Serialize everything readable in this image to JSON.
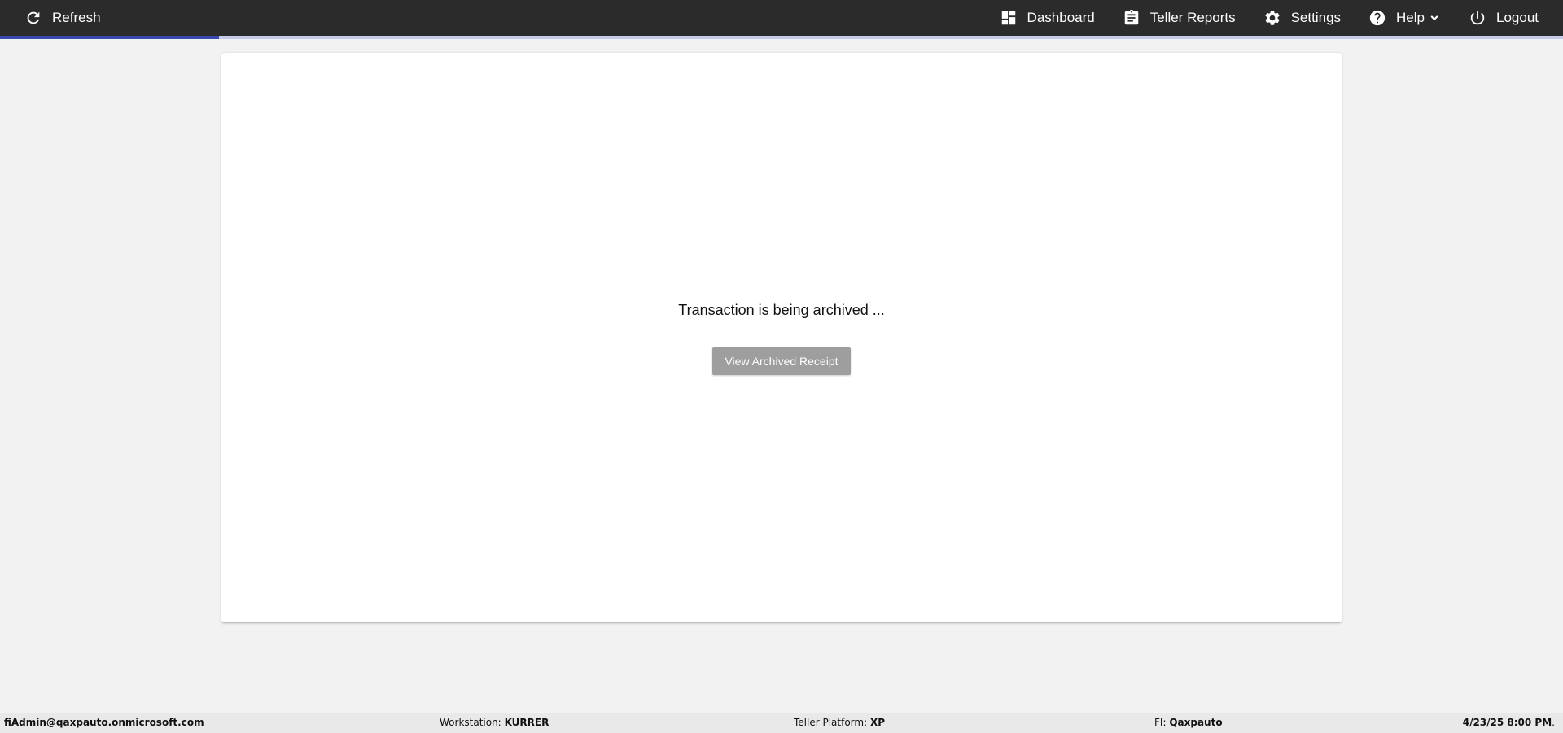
{
  "toolbar": {
    "refresh_label": "Refresh",
    "dashboard_label": "Dashboard",
    "teller_reports_label": "Teller Reports",
    "settings_label": "Settings",
    "help_label": "Help",
    "logout_label": "Logout"
  },
  "icons": {
    "refresh": "refresh-icon",
    "dashboard": "dashboard-icon",
    "teller_reports": "clipboard-icon",
    "settings": "gear-icon",
    "help": "help-circle-icon",
    "help_menu": "chevron-down-icon",
    "logout": "power-icon"
  },
  "progress": {
    "fraction": 0.14,
    "fill_color": "#3949ab",
    "track_color": "#c5cae9"
  },
  "main": {
    "status_message": "Transaction is being archived ...",
    "view_receipt_label": "View Archived Receipt"
  },
  "footer": {
    "user": "fiAdmin@qaxpauto.onmicrosoft.com",
    "workstation_label": "Workstation:",
    "workstation_value": "KURRER",
    "platform_label": "Teller Platform:",
    "platform_value": "XP",
    "fi_label": "FI:",
    "fi_value": "Qaxpauto",
    "datetime": "4/23/25 8:00 PM"
  },
  "colors": {
    "topbar": "#2b2b2b",
    "page_background": "#f2f2f2",
    "button_disabled": "#9e9e9e",
    "footer_background": "#e9e9e9"
  }
}
